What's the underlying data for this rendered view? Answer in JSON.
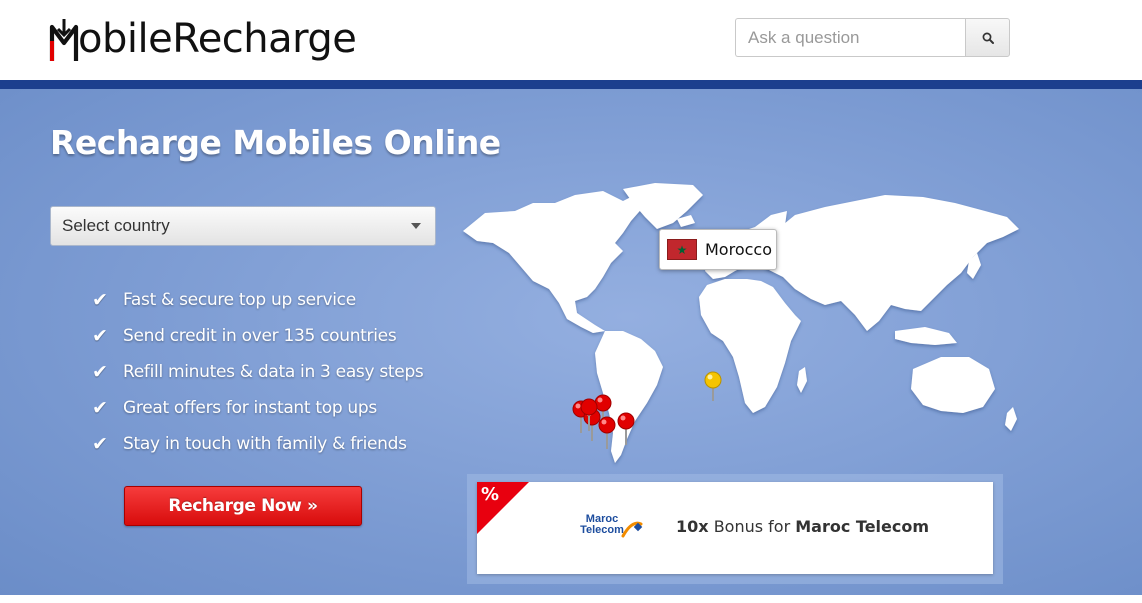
{
  "header": {
    "logo_text": "MobileRecharge",
    "logo_text_rest": "obileRecharge",
    "search": {
      "placeholder": "Ask a question",
      "button_icon": "search-icon"
    }
  },
  "hero": {
    "title": "Recharge Mobiles Online",
    "country_select": {
      "selected": "Select country",
      "icon": "chevron-down-icon"
    },
    "features": [
      {
        "icon": "check-icon",
        "text": "Fast & secure top up service"
      },
      {
        "icon": "check-icon",
        "text": "Send credit in over 135 countries"
      },
      {
        "icon": "check-icon",
        "text": "Refill minutes & data in 3 easy steps"
      },
      {
        "icon": "check-icon",
        "text": "Great offers for instant top ups"
      },
      {
        "icon": "check-icon",
        "text": "Stay in touch with family & friends"
      }
    ],
    "cta_label": "Recharge Now »"
  },
  "map": {
    "highlighted_country": "Morocco",
    "flag_icon": "morocco-flag-icon",
    "pins": [
      {
        "color": "#e10000"
      },
      {
        "color": "#e10000"
      },
      {
        "color": "#e10000"
      },
      {
        "color": "#e10000"
      },
      {
        "color": "#e10000"
      },
      {
        "color": "#e10000"
      },
      {
        "color": "#e10000"
      },
      {
        "color": "#f5c400"
      }
    ]
  },
  "promo": {
    "badge": "%",
    "operator_logo_text": "Maroc Telecom",
    "multiplier": "10x",
    "text": "Bonus for",
    "operator": "Maroc Telecom"
  },
  "colors": {
    "brand_blue": "#1c3f8e",
    "hero_blue": "#7d9cd3",
    "cta_red": "#e81e1e",
    "promo_red": "#e8000f"
  }
}
